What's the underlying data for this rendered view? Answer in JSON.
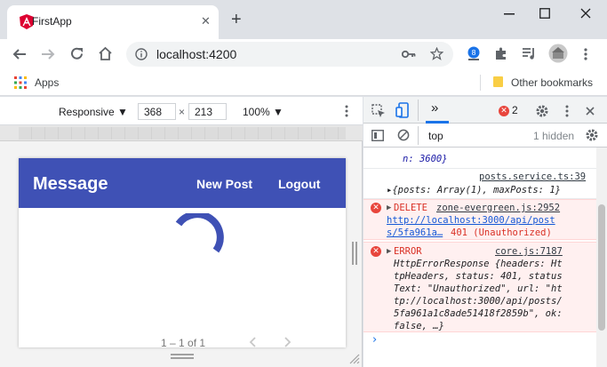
{
  "browser": {
    "tab_title": "FirstApp",
    "tab_close": "✕",
    "new_tab": "+",
    "url": "localhost:4200",
    "bookmarks_apps": "Apps",
    "other_bookmarks": "Other bookmarks"
  },
  "device_toolbar": {
    "mode": "Responsive ▼",
    "width": "368",
    "times": "×",
    "height": "213",
    "zoom": "100% ▼"
  },
  "app": {
    "title": "Message",
    "nav_new_post": "New Post",
    "nav_logout": "Logout",
    "paginator": "1 – 1 of 1",
    "spinner_color": "#3f51b5"
  },
  "devtools": {
    "more_tabs": "»",
    "error_count": "2",
    "filter_context": "top",
    "hidden_count": "1 hidden",
    "prompt": "›",
    "lines": {
      "frag1": "n: 3600}",
      "log_src": "posts.service.ts:39",
      "log_obj": "▸{posts: Array(1), maxPosts: 1}",
      "delete_label": "DELETE",
      "delete_src": "zone-evergreen.js:2952",
      "delete_url1": "http://localhost:3000/api/post",
      "delete_url2": "s/5fa961a…",
      "delete_status": "401 (Unauthorized)",
      "error_label": "ERROR",
      "error_src": "core.js:7187",
      "err1": "HttpErrorResponse {headers: Ht",
      "err2": "tpHeaders, status: 401, status",
      "err3": "Text: \"Unauthorized\", url: \"ht",
      "err4": "tp://localhost:3000/api/posts/",
      "err5": "5fa961a1c8ade51418f2859b\", ok:",
      "err6": "false, …}"
    }
  },
  "colors": {
    "header": "#3f51b5",
    "error": "#e8453c"
  }
}
